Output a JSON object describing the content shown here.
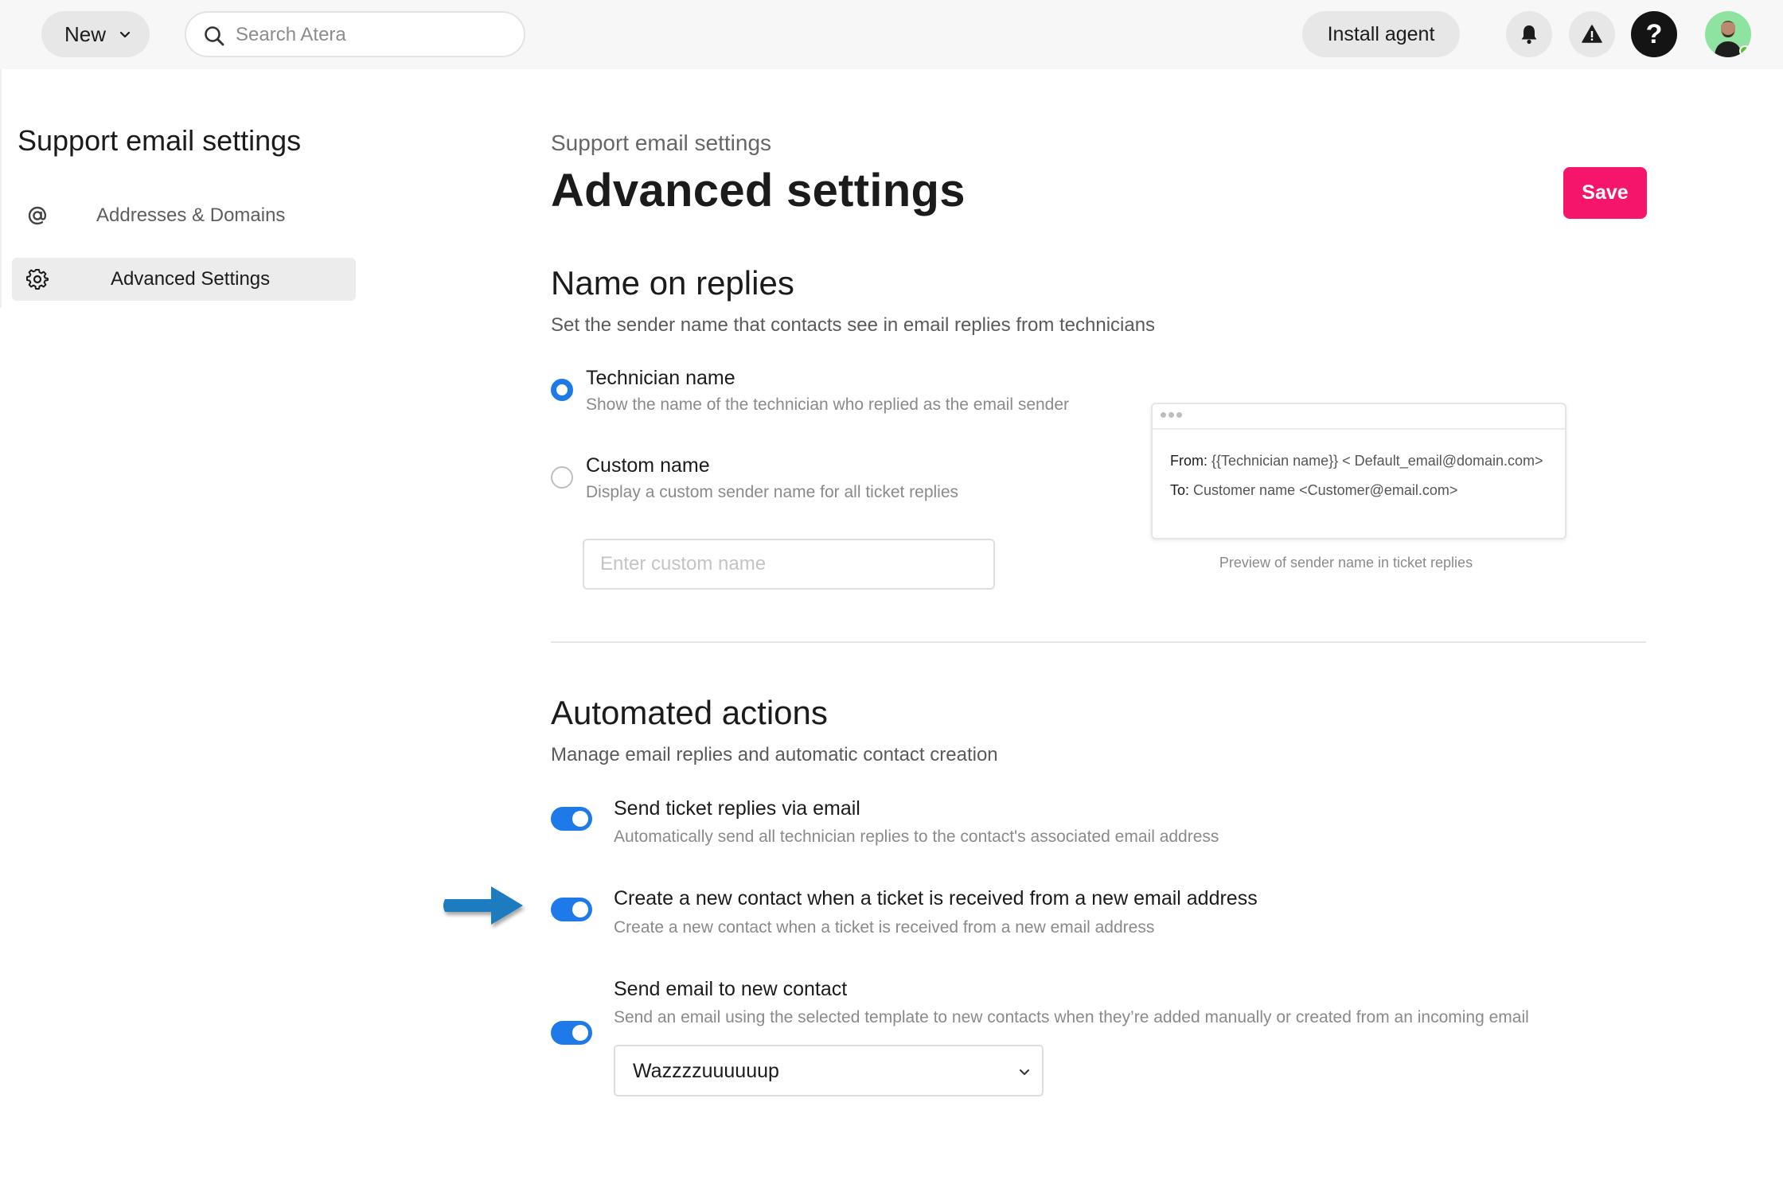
{
  "topbar": {
    "new_label": "New",
    "search_placeholder": "Search Atera",
    "install_label": "Install agent",
    "help_label": "?"
  },
  "sidebar": {
    "title": "Support email settings",
    "items": [
      {
        "label": "Addresses & Domains",
        "icon": "at-icon",
        "active": false
      },
      {
        "label": "Advanced Settings",
        "icon": "gear-icon",
        "active": true
      }
    ]
  },
  "main": {
    "breadcrumb": "Support email settings",
    "title": "Advanced settings",
    "save_label": "Save",
    "name_on_replies": {
      "heading": "Name on replies",
      "subtitle": "Set the sender name that contacts see in email replies from technicians",
      "options": [
        {
          "title": "Technician name",
          "desc": "Show the name of the technician who replied as the email sender",
          "selected": true
        },
        {
          "title": "Custom name",
          "desc": "Display a custom sender name for all ticket replies",
          "selected": false
        }
      ],
      "custom_placeholder": "Enter custom name",
      "preview": {
        "from_label": "From:",
        "from_value": "{{Technician name}} < Default_email@domain.com>",
        "to_label": "To:",
        "to_value": "Customer name <Customer@email.com>",
        "caption": "Preview of sender name in ticket replies"
      }
    },
    "automated_actions": {
      "heading": "Automated actions",
      "subtitle": "Manage email replies and automatic contact creation",
      "toggles": [
        {
          "title": "Send ticket replies via email",
          "desc": "Automatically send all technician replies to the contact's associated email address",
          "on": true
        },
        {
          "title": "Create a new contact when a ticket is received from a new email address",
          "desc": "Create a new contact when a ticket is received from a new email address",
          "on": true
        },
        {
          "title": "Send email to new contact",
          "desc": "Send an email using the selected template to new contacts when they’re added manually or created from an incoming email",
          "on": true
        }
      ],
      "template_value": "Wazzzzuuuuuup"
    }
  },
  "colors": {
    "accent": "#1d7ae8",
    "save": "#f5166b",
    "annotation_arrow": "#1a7bbf"
  }
}
